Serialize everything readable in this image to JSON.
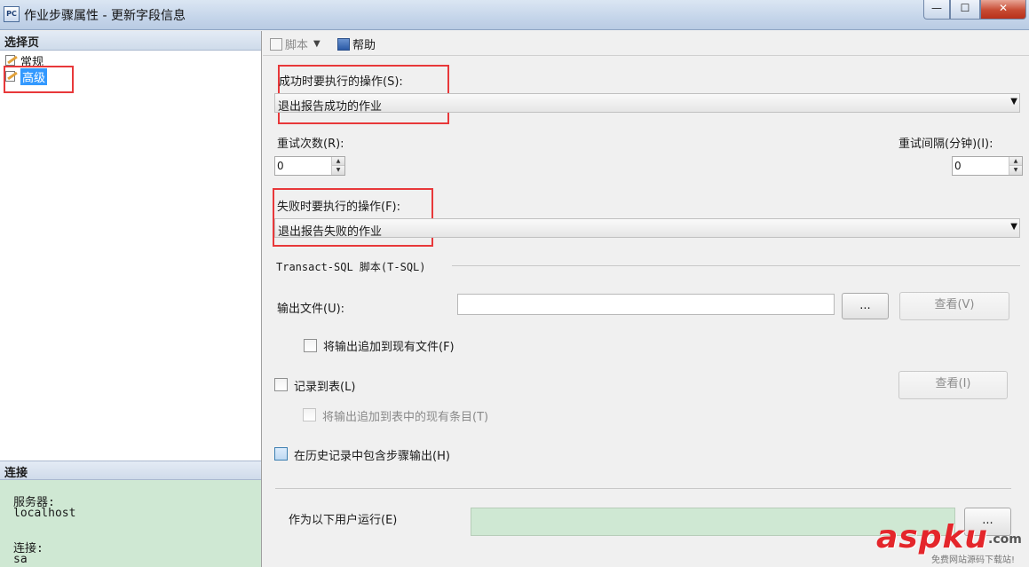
{
  "window": {
    "title": "作业步骤属性 - 更新字段信息",
    "app_icon": "PC",
    "controls": {
      "minimize": "—",
      "maximize": "☐",
      "close": "✕"
    }
  },
  "left_panel": {
    "header": "选择页",
    "pages": [
      {
        "label": "常规",
        "icon": "page-edit-icon",
        "selected": false
      },
      {
        "label": "高级",
        "icon": "page-edit-icon",
        "selected": true
      }
    ],
    "connection": {
      "header": "连接",
      "server_label": "服务器:",
      "server_value": "localhost",
      "conn_label": "连接:",
      "conn_value": "sa"
    }
  },
  "toolbar": {
    "script_label": "脚本",
    "help_label": "帮助"
  },
  "form": {
    "on_success_label": "成功时要执行的操作(S):",
    "on_success_value": "退出报告成功的作业",
    "retry_count_label": "重试次数(R):",
    "retry_count_value": "0",
    "retry_interval_label": "重试间隔(分钟)(I):",
    "retry_interval_value": "0",
    "on_failure_label": "失败时要执行的操作(F):",
    "on_failure_value": "退出报告失败的作业",
    "tsql_group_label": "Transact-SQL 脚本(T-SQL)",
    "output_file_label": "输出文件(U):",
    "output_file_value": "",
    "browse_label": "...",
    "view_file_label": "查看(V)",
    "append_file_label": "将输出追加到现有文件(F)",
    "log_table_label": "记录到表(L)",
    "view_table_label": "查看(I)",
    "append_table_label": "将输出追加到表中的现有条目(T)",
    "include_history_label": "在历史记录中包含步骤输出(H)",
    "run_as_label": "作为以下用户运行(E)",
    "run_as_value": "",
    "run_as_browse_label": "..."
  },
  "watermark": {
    "brand": "aspku",
    "suffix": ".com",
    "tagline": "免费网站源码下载站!"
  },
  "colors": {
    "highlight_box": "#e8383a",
    "selection": "#3399ff",
    "connection_bg": "#cfe8d3"
  }
}
